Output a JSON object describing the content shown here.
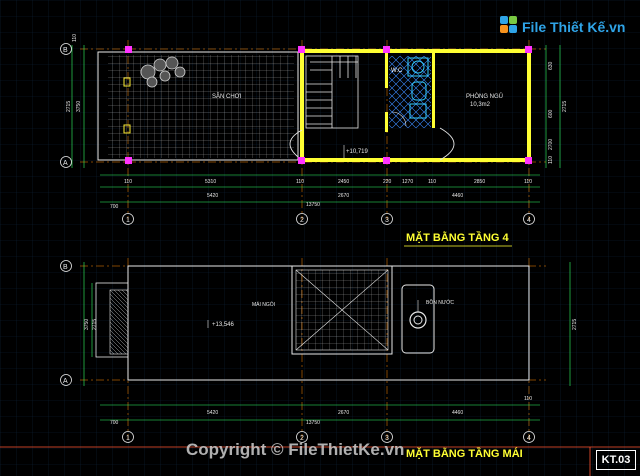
{
  "logo": {
    "text": "File Thiết Kế.vn"
  },
  "watermark": {
    "text": "Copyright © FileThietKe.vn"
  },
  "sheet": {
    "code": "KT.03"
  },
  "plan1": {
    "title": "MẶT BẰNG TẦNG 4",
    "rooms": {
      "terrace": "SÂN CHƠI",
      "wc": "W.C",
      "bedroom": "PHÒNG NGỦ",
      "bedroom_area": "10,3m2"
    },
    "level": "+10,719",
    "axes_v": [
      "B",
      "A"
    ],
    "axes_h": [
      "1",
      "2",
      "3",
      "4"
    ],
    "dims_top": [
      "110",
      "5310",
      "110",
      "2450",
      "220",
      "1270",
      "110",
      "2850",
      "110"
    ],
    "dims_mid": [
      "5420",
      "2670",
      "4460"
    ],
    "dims_total": "13750",
    "edge_left": "700",
    "dims_left": [
      "110",
      "3750",
      "2715"
    ],
    "dims_right": [
      "630",
      "2715",
      "600",
      "2700",
      "110"
    ]
  },
  "plan2": {
    "title": "MẶT BẰNG TẦNG MÁI",
    "labels": {
      "roof": "MÁI NGÓI",
      "tank": "BỒN NƯỚC"
    },
    "level": "+13,546",
    "axes_v": [
      "B",
      "A"
    ],
    "axes_h": [
      "1",
      "2",
      "3",
      "4"
    ],
    "dims_mid": [
      "5420",
      "2670",
      "4460"
    ],
    "dims_total": "13750",
    "edge_left": "700",
    "edge_right": "110",
    "dims_left": [
      "3750",
      "2715"
    ],
    "dims_right": "2715"
  },
  "colors": {
    "bg": "#000000",
    "grid": "#0a1a2a",
    "line": "#e8e8e8",
    "wall": "#ffff33",
    "cyan": "#33ffff",
    "magenta": "#ff33ff",
    "dim": "#33ff66",
    "blue": "#3399ff"
  }
}
